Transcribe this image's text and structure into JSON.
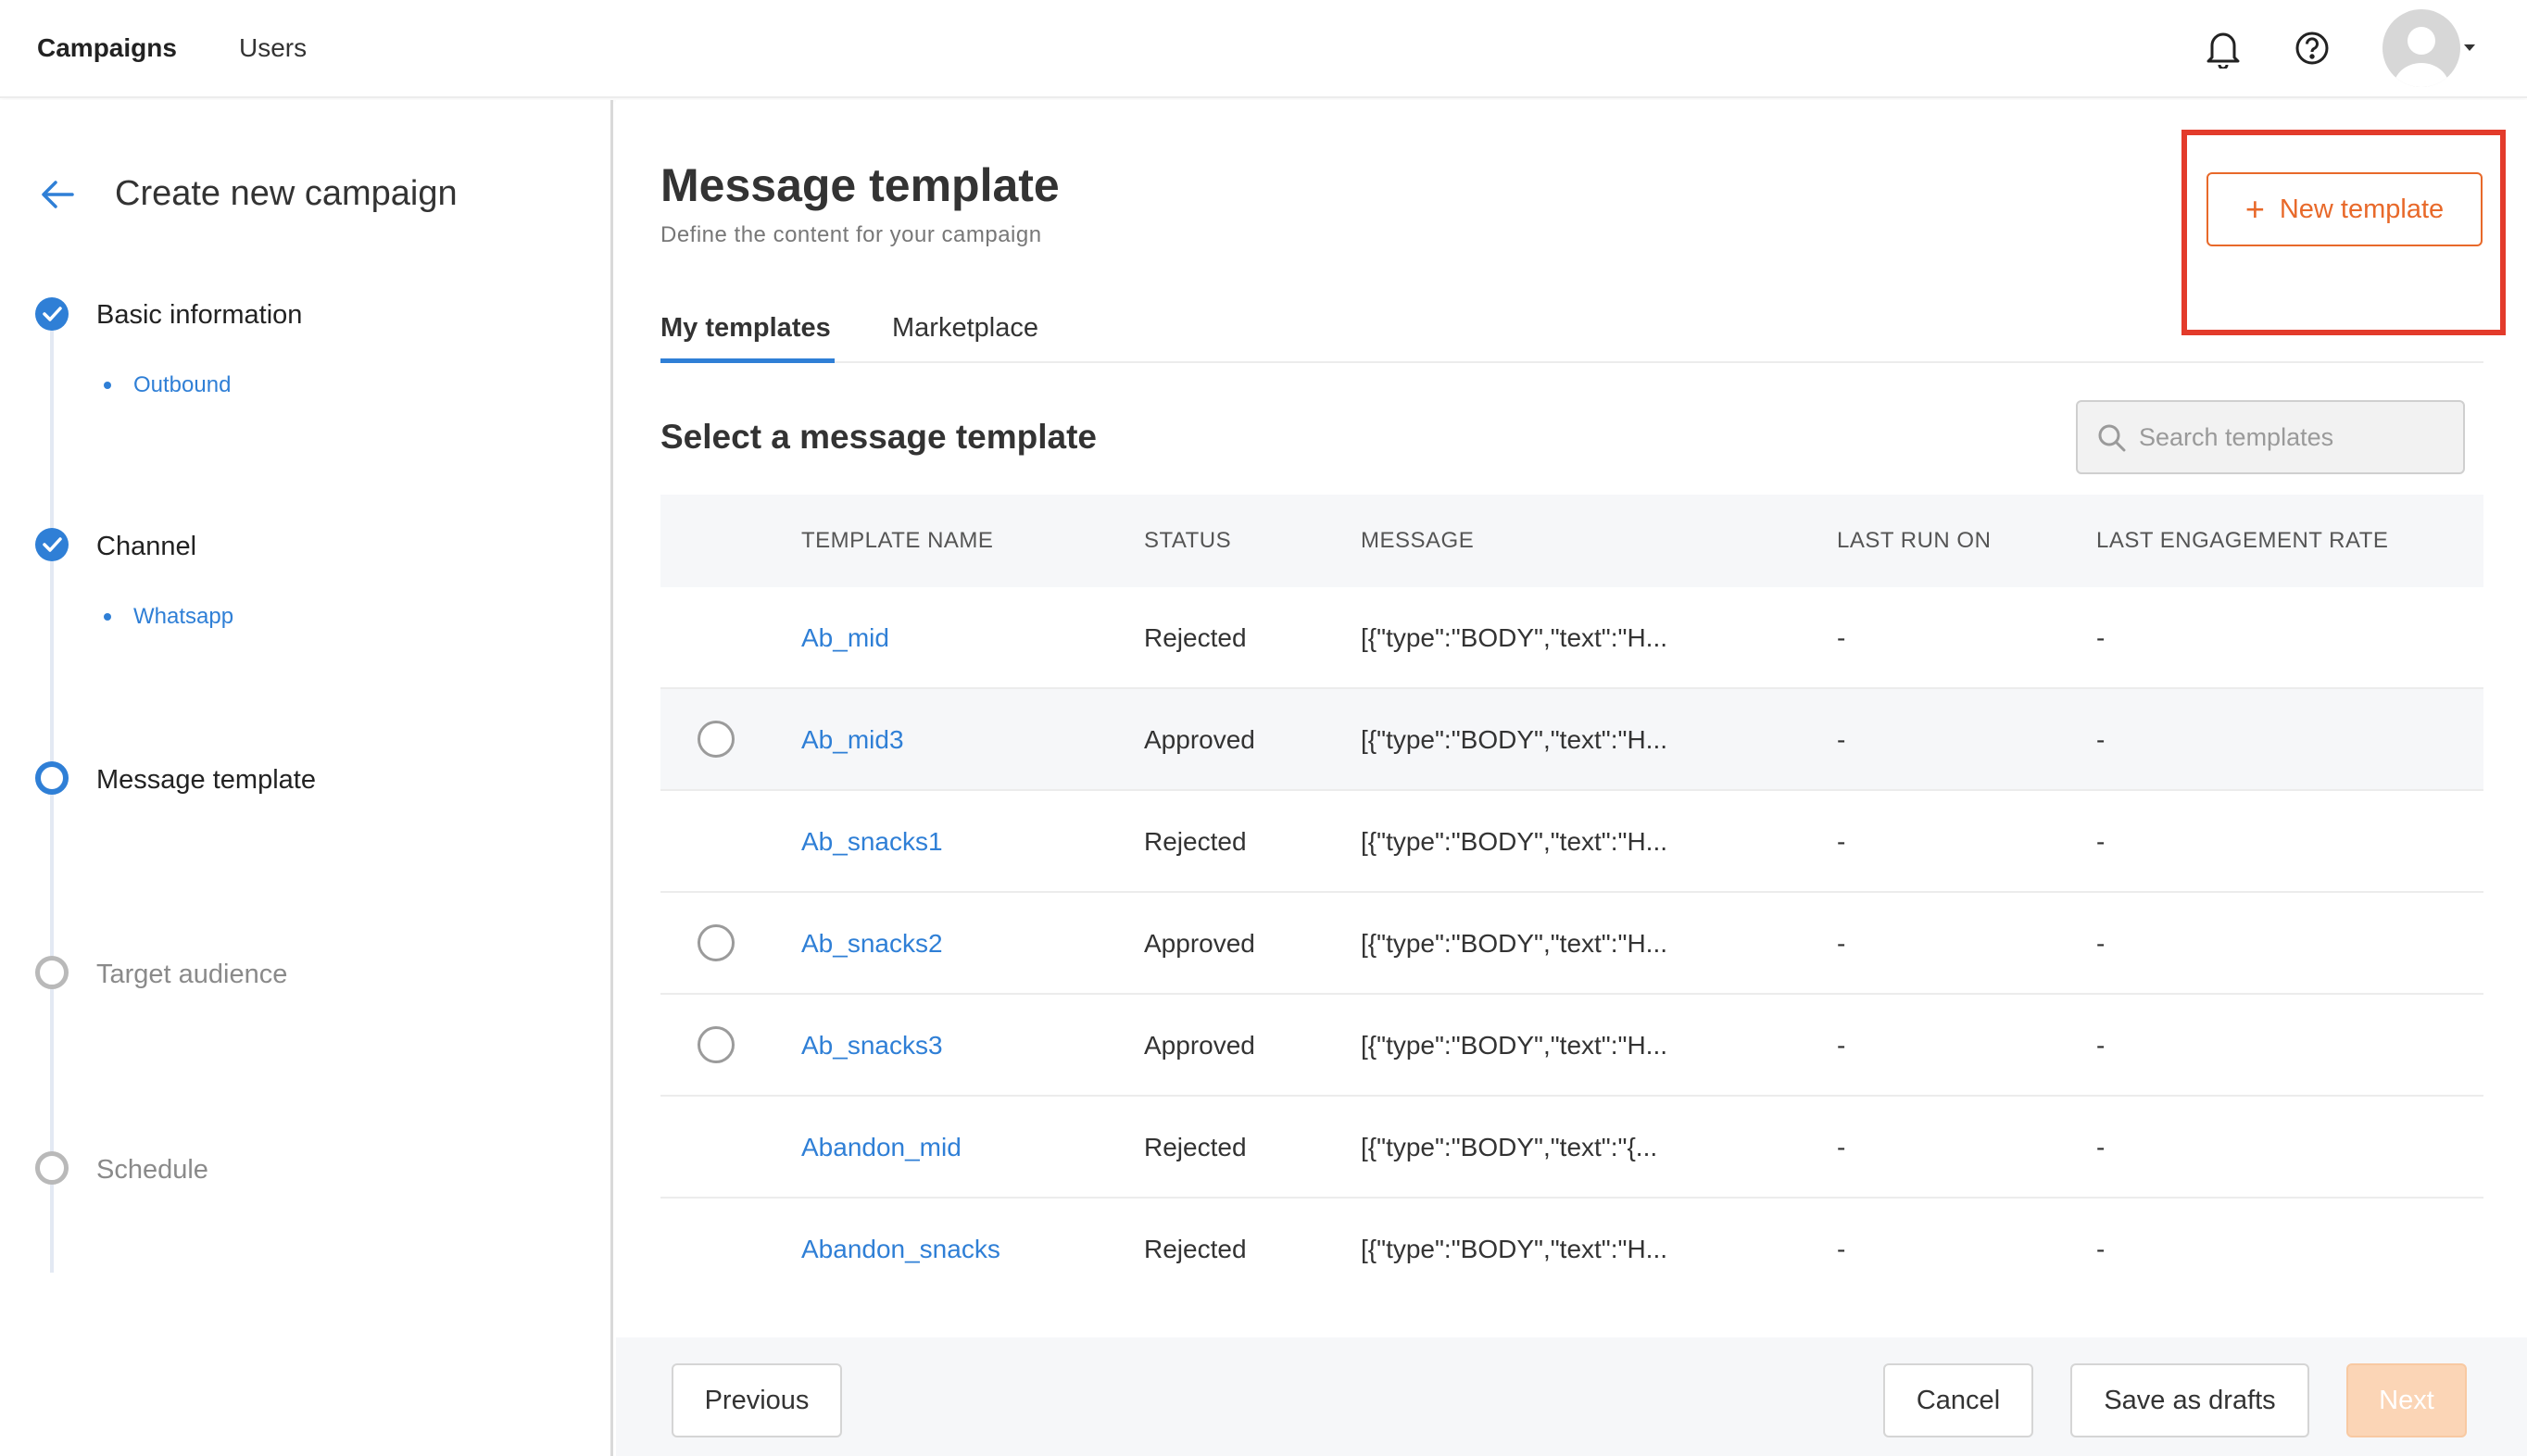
{
  "topnav": {
    "items": [
      {
        "label": "Campaigns",
        "active": true
      },
      {
        "label": "Users",
        "active": false
      }
    ],
    "icons": [
      "bell-icon",
      "help-icon",
      "user-avatar-icon"
    ]
  },
  "sidebar": {
    "title": "Create new campaign",
    "steps": [
      {
        "label": "Basic information",
        "state": "done",
        "sub": "Outbound"
      },
      {
        "label": "Channel",
        "state": "done",
        "sub": "Whatsapp"
      },
      {
        "label": "Message template",
        "state": "current"
      },
      {
        "label": "Target audience",
        "state": "todo"
      },
      {
        "label": "Schedule",
        "state": "todo"
      }
    ]
  },
  "main": {
    "title": "Message template",
    "subtitle": "Define the content for your campaign",
    "new_template_label": "New template",
    "tabs": [
      {
        "label": "My templates",
        "active": true
      },
      {
        "label": "Marketplace",
        "active": false
      }
    ],
    "section_title": "Select a message template",
    "search_placeholder": "Search templates",
    "table": {
      "headers": [
        "TEMPLATE NAME",
        "STATUS",
        "MESSAGE",
        "LAST RUN ON",
        "LAST ENGAGEMENT RATE"
      ],
      "rows": [
        {
          "name": "Ab_mid",
          "status": "Rejected",
          "message": "[{\"type\":\"BODY\",\"text\":\"H...",
          "last_run": "-",
          "engagement": "-",
          "selectable": false
        },
        {
          "name": "Ab_mid3",
          "status": "Approved",
          "message": "[{\"type\":\"BODY\",\"text\":\"H...",
          "last_run": "-",
          "engagement": "-",
          "selectable": true
        },
        {
          "name": "Ab_snacks1",
          "status": "Rejected",
          "message": "[{\"type\":\"BODY\",\"text\":\"H...",
          "last_run": "-",
          "engagement": "-",
          "selectable": false
        },
        {
          "name": "Ab_snacks2",
          "status": "Approved",
          "message": "[{\"type\":\"BODY\",\"text\":\"H...",
          "last_run": "-",
          "engagement": "-",
          "selectable": true
        },
        {
          "name": "Ab_snacks3",
          "status": "Approved",
          "message": "[{\"type\":\"BODY\",\"text\":\"H...",
          "last_run": "-",
          "engagement": "-",
          "selectable": true
        },
        {
          "name": "Abandon_mid",
          "status": "Rejected",
          "message": "[{\"type\":\"BODY\",\"text\":\"{...",
          "last_run": "-",
          "engagement": "-",
          "selectable": false
        },
        {
          "name": "Abandon_snacks",
          "status": "Rejected",
          "message": "[{\"type\":\"BODY\",\"text\":\"H...",
          "last_run": "-",
          "engagement": "-",
          "selectable": false
        }
      ]
    }
  },
  "footer": {
    "previous_label": "Previous",
    "cancel_label": "Cancel",
    "save_label": "Save as drafts",
    "next_label": "Next"
  },
  "colors": {
    "accent_blue": "#2f7fd6",
    "accent_orange": "#e8692a",
    "highlight_red": "#e33b2b",
    "next_disabled": "#fbd5b6"
  }
}
